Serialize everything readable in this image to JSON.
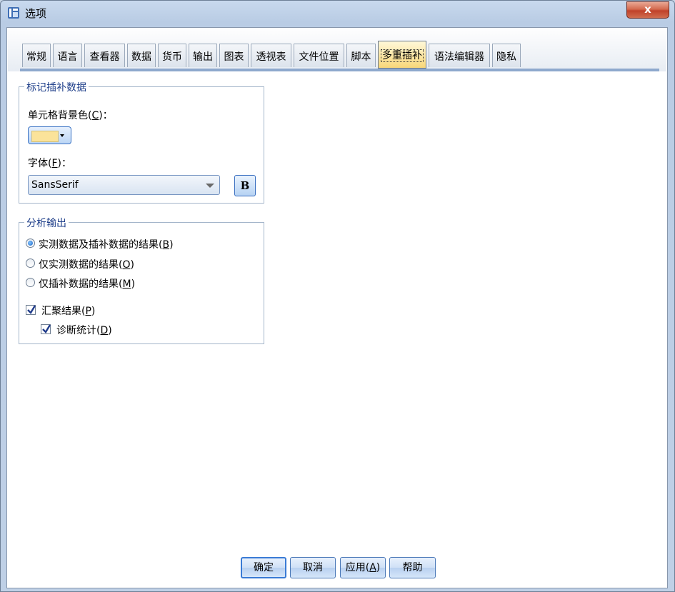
{
  "window": {
    "title": "选项",
    "close_label": "x"
  },
  "tabs": [
    {
      "label": "常规"
    },
    {
      "label": "语言"
    },
    {
      "label": "查看器"
    },
    {
      "label": "数据"
    },
    {
      "label": "货币"
    },
    {
      "label": "输出"
    },
    {
      "label": "图表"
    },
    {
      "label": "透视表"
    },
    {
      "label": "文件位置"
    },
    {
      "label": "脚本"
    },
    {
      "label": "多重插补",
      "active": true
    },
    {
      "label": "语法编辑器"
    },
    {
      "label": "隐私"
    }
  ],
  "imputed_group": {
    "title": "标记插补数据",
    "cell_bg_label": "单元格背景色(",
    "cell_bg_mnemonic": "C",
    "cell_bg_suffix": ")：",
    "cell_bg_color": "#fbe39a",
    "font_label": "字体(",
    "font_mnemonic": "F",
    "font_suffix": ")：",
    "font_value": "SansSerif",
    "bold_label": "B"
  },
  "output_group": {
    "title": "分析输出",
    "options": [
      {
        "text": "实测数据及插补数据的结果(",
        "mnemonic": "B",
        "suffix": ")",
        "checked": true
      },
      {
        "text": "仅实测数据的结果(",
        "mnemonic": "O",
        "suffix": ")",
        "checked": false
      },
      {
        "text": "仅插补数据的结果(",
        "mnemonic": "M",
        "suffix": ")",
        "checked": false
      }
    ],
    "pooled": {
      "text": "汇聚结果(",
      "mnemonic": "P",
      "suffix": ")",
      "checked": true
    },
    "diagnostics": {
      "text": "诊断统计(",
      "mnemonic": "D",
      "suffix": ")",
      "checked": true
    }
  },
  "buttons": {
    "ok": "确定",
    "cancel": "取消",
    "apply_text": "应用(",
    "apply_mnemonic": "A",
    "apply_suffix": ")",
    "help": "帮助"
  }
}
